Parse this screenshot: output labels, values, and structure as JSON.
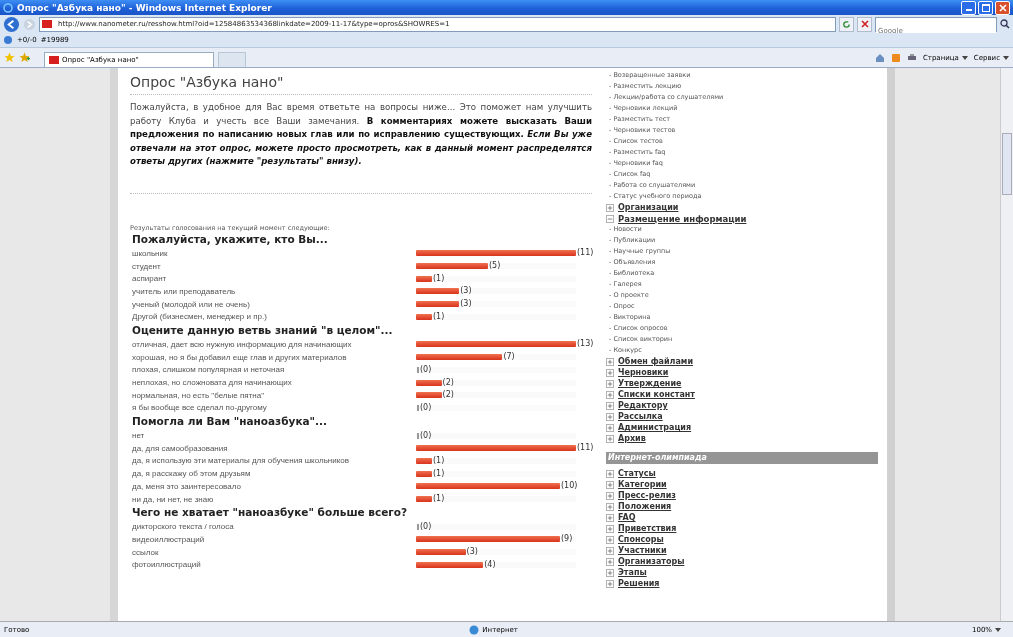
{
  "window": {
    "title": "Опрос \"Азбука нано\" - Windows Internet Explorer"
  },
  "address_bar": {
    "url": "http://www.nanometer.ru/resshow.html?oid=12584863534368linkdate=2009-11-17&type=opros&SHOWRES=1",
    "search_placeholder": "Google"
  },
  "links_bar": {
    "counter": "+0/-0",
    "item": "#19989"
  },
  "tab": {
    "label": "Опрос \"Азбука нано\""
  },
  "command_bar": {
    "items": [
      "Страница",
      "Сервис"
    ]
  },
  "page": {
    "title": "Опрос \"Азбука нано\"",
    "intro": "Пожалуйста, в удобное для Вас время ответьте на вопросы ниже... Это поможет нам улучшить работу Клуба и учесть все Ваши замечания. **В комментариях можете высказать Ваши предложения по написанию новых глав или по исправлению существующих.** *Если Вы уже отвечали на этот опрос, можете просто просмотреть, как в данный момент распределятся ответы других (нажмите \"результаты\" внизу).*",
    "results_label": "Результаты голосования на текущий момент следующие:",
    "questions": [
      {
        "title": "Пожалуйста, укажите, кто Вы...",
        "answers": [
          {
            "label": "школьник",
            "count": "(11)",
            "level": 1
          },
          {
            "label": "студент",
            "count": "(5)",
            "level": 0.45
          },
          {
            "label": "аспирант",
            "count": "(1)",
            "level": 0.1
          },
          {
            "label": "учитель или преподаватель",
            "count": "(3)",
            "level": 0.27
          },
          {
            "label": "ученый (молодой или не очень)",
            "count": "(3)",
            "level": 0.27
          },
          {
            "label": "Другой (бизнесмен, менеджер и пр.)",
            "count": "(1)",
            "level": 0.1
          }
        ]
      },
      {
        "title": "Оцените данную ветвь знаний \"в целом\"...",
        "answers": [
          {
            "label": "отличная, дает всю нужную информацию для начинающих",
            "count": "(13)",
            "level": 1
          },
          {
            "label": "хорошая, но я бы добавил еще глав и других материалов",
            "count": "(7)",
            "level": 0.54
          },
          {
            "label": "плохая, слишком популярная и неточная",
            "count": "(0)",
            "level": 0
          },
          {
            "label": "неплохая, но сложновата для начинающих",
            "count": "(2)",
            "level": 0.16
          },
          {
            "label": "нормальная, но есть \"белые пятна\"",
            "count": "(2)",
            "level": 0.16
          },
          {
            "label": "я бы вообще все сделал по-другому",
            "count": "(0)",
            "level": 0
          }
        ]
      },
      {
        "title": "Помогла ли Вам \"наноазбука\"...",
        "answers": [
          {
            "label": "нет",
            "count": "(0)",
            "level": 0
          },
          {
            "label": "да, для самообразования",
            "count": "(11)",
            "level": 1
          },
          {
            "label": "да, я использую эти материалы для обучения школьников",
            "count": "(1)",
            "level": 0.1
          },
          {
            "label": "да, я расскажу об этом друзьям",
            "count": "(1)",
            "level": 0.1
          },
          {
            "label": "да, меня это заинтересовало",
            "count": "(10)",
            "level": 0.9
          },
          {
            "label": "ни да, ни нет, не знаю",
            "count": "(1)",
            "level": 0.1
          }
        ]
      },
      {
        "title": "Чего не хватает \"наноазбуке\" больше всего?",
        "answers": [
          {
            "label": "дикторского текста / голоса",
            "count": "(0)",
            "level": 0
          },
          {
            "label": "видеоиллюстраций",
            "count": "(9)",
            "level": 0.9
          },
          {
            "label": "ссылок",
            "count": "(3)",
            "level": 0.31
          },
          {
            "label": "фотоиллюстраций",
            "count": "(4)",
            "level": 0.42
          }
        ]
      }
    ]
  },
  "sidebar": {
    "items": [
      {
        "kind": "item",
        "label": "- Возвращенные заявки"
      },
      {
        "kind": "item",
        "label": "- Разместить лекцию"
      },
      {
        "kind": "item",
        "label": "- Лекции/работа со слушателями"
      },
      {
        "kind": "item",
        "label": "- Черновики лекций"
      },
      {
        "kind": "item",
        "label": "- Разместить тест"
      },
      {
        "kind": "item",
        "label": "- Черновики тестов"
      },
      {
        "kind": "item",
        "label": "- Список тестов"
      },
      {
        "kind": "item",
        "label": "- Разместить faq"
      },
      {
        "kind": "item",
        "label": "- Черновики faq"
      },
      {
        "kind": "item",
        "label": "- Список faq"
      },
      {
        "kind": "item",
        "label": "- Работа со слушателями"
      },
      {
        "kind": "item",
        "label": "- Статус учебного периода"
      },
      {
        "kind": "section",
        "label": "Организации",
        "expanded": false
      },
      {
        "kind": "section",
        "label": "Размещение информации",
        "expanded": true
      },
      {
        "kind": "item",
        "label": "- Новости"
      },
      {
        "kind": "item",
        "label": "- Публикации"
      },
      {
        "kind": "item",
        "label": "- Научные группы"
      },
      {
        "kind": "item",
        "label": "- Объявления"
      },
      {
        "kind": "item",
        "label": "- Библиотека"
      },
      {
        "kind": "item",
        "label": "- Галерея"
      },
      {
        "kind": "item",
        "label": "- О проекте"
      },
      {
        "kind": "item",
        "label": "- Опрос"
      },
      {
        "kind": "item",
        "label": "- Викторина"
      },
      {
        "kind": "item",
        "label": "- Список опросов"
      },
      {
        "kind": "item",
        "label": "- Список викторин"
      },
      {
        "kind": "item",
        "label": "- Конкурс"
      },
      {
        "kind": "section",
        "label": "Обмен файлами",
        "expanded": false
      },
      {
        "kind": "section",
        "label": "Черновики",
        "expanded": false
      },
      {
        "kind": "section",
        "label": "Утверждение",
        "expanded": false
      },
      {
        "kind": "section",
        "label": "Списки констант",
        "expanded": false
      },
      {
        "kind": "section",
        "label": "Редактору",
        "expanded": false
      },
      {
        "kind": "section",
        "label": "Рассылка",
        "expanded": false
      },
      {
        "kind": "section",
        "label": "Администрация",
        "expanded": false
      },
      {
        "kind": "section",
        "label": "Архив",
        "expanded": false
      },
      {
        "kind": "header",
        "label": "Интернет-олимпиада"
      },
      {
        "kind": "section",
        "label": "Статусы",
        "expanded": false
      },
      {
        "kind": "section",
        "label": "Категории",
        "expanded": false
      },
      {
        "kind": "section",
        "label": "Пресс-релиз",
        "expanded": false
      },
      {
        "kind": "section",
        "label": "Положения",
        "expanded": false
      },
      {
        "kind": "section",
        "label": "FAQ",
        "expanded": false
      },
      {
        "kind": "section",
        "label": "Приветствия",
        "expanded": false
      },
      {
        "kind": "section",
        "label": "Спонсоры",
        "expanded": false
      },
      {
        "kind": "section",
        "label": "Участники",
        "expanded": false
      },
      {
        "kind": "section",
        "label": "Организаторы",
        "expanded": false
      },
      {
        "kind": "section",
        "label": "Этапы",
        "expanded": false
      },
      {
        "kind": "section",
        "label": "Решения",
        "expanded": false
      }
    ]
  },
  "status_bar": {
    "text": "Готово",
    "zone": "Интернет",
    "zoom": "100%"
  }
}
